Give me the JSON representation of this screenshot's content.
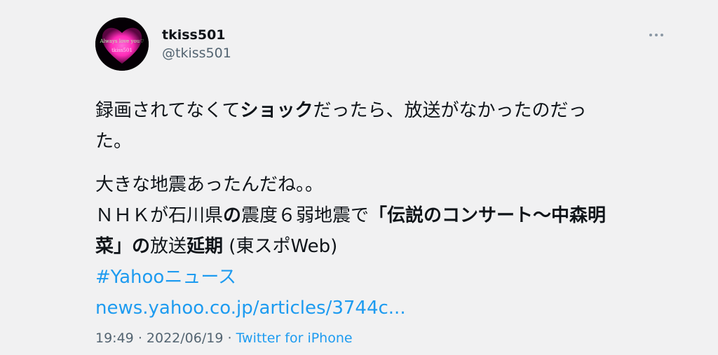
{
  "user": {
    "display_name": "tkiss501",
    "handle": "@tkiss501",
    "avatar_text_line1": "Always love you♡",
    "avatar_text_line2": "tkiss501"
  },
  "tweet": {
    "para1_line1": [
      "録画されてなくて",
      "ショック",
      "だったら、放送がなかったのだっ"
    ],
    "para1_line2": "た。",
    "para2_line1": "大きな地震あったんだね。。",
    "para2_line2": [
      "ＮＨＫが石川県",
      "の",
      "震度６弱地震で",
      "「伝説のコンサート～中森明"
    ],
    "para2_line3": [
      "菜」の",
      "放送",
      "延期",
      " (東スポWeb)"
    ],
    "hashtag": "#Yahooニュース",
    "link": "news.yahoo.co.jp/articles/3744c..."
  },
  "meta": {
    "time": "19:49",
    "date": "2022/06/19",
    "separator": "·",
    "source": "Twitter for iPhone"
  },
  "colors": {
    "background": "#f1f1f2",
    "link": "#1d9bf0",
    "secondary_text": "#536471",
    "avatar_heart": "#ff2bb8"
  },
  "icons": {
    "more": "more-dots-icon"
  }
}
